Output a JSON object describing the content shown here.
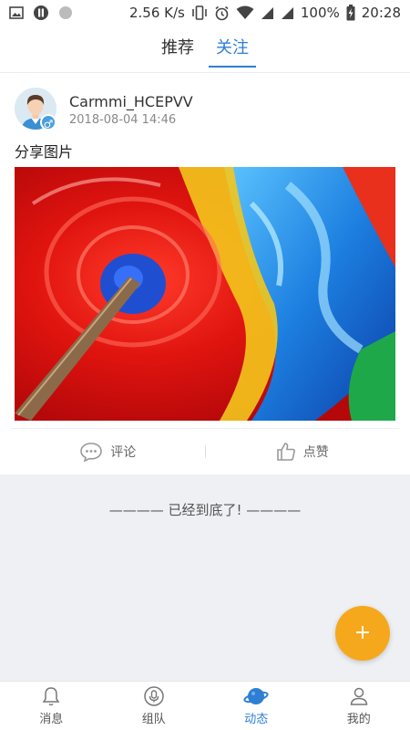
{
  "status_bar": {
    "speed": "2.56 K/s",
    "battery": "100%",
    "time": "20:28"
  },
  "top_tabs": [
    {
      "label": "推荐",
      "active": false
    },
    {
      "label": "关注",
      "active": true
    }
  ],
  "post": {
    "username": "Carmmi_HCEPVV",
    "date": "2018-08-04 14:46",
    "text": "分享图片",
    "gender_symbol": "♂",
    "actions": {
      "comment_label": "评论",
      "like_label": "点赞"
    }
  },
  "end_text": "———— 已经到底了! ————",
  "fab_label": "+",
  "bottom_nav": [
    {
      "label": "消息",
      "icon": "bell-icon",
      "active": false
    },
    {
      "label": "组队",
      "icon": "microphone-icon",
      "active": false
    },
    {
      "label": "动态",
      "icon": "planet-icon",
      "active": true
    },
    {
      "label": "我的",
      "icon": "user-icon",
      "active": false
    }
  ],
  "colors": {
    "accent": "#2e7fd4",
    "fab": "#f6a81c"
  }
}
